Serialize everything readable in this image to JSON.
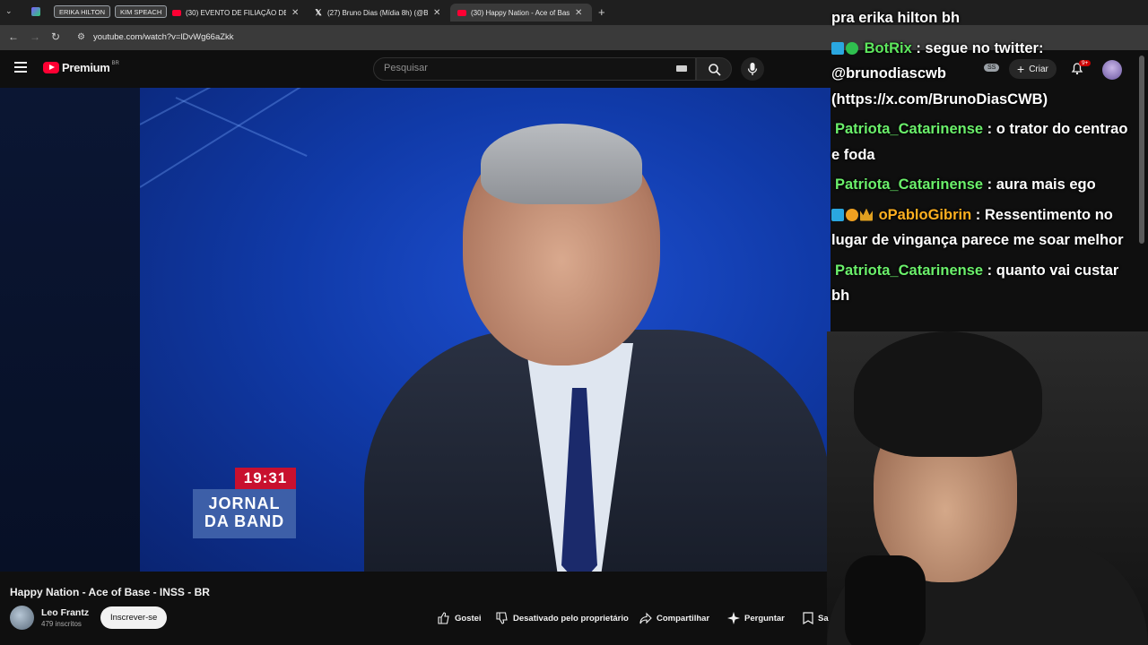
{
  "browser": {
    "pills": [
      "ERIKA HILTON",
      "KIM SPEACH"
    ],
    "tabs": [
      {
        "title": "(30) EVENTO DE FILIAÇÃO DE K",
        "icon": "youtube-icon"
      },
      {
        "title": "(27) Bruno Dias (Mídia 8h) (@B",
        "icon": "x-icon"
      },
      {
        "title": "(30) Happy Nation - Ace of Bas",
        "icon": "youtube-icon",
        "active": true
      }
    ],
    "url": "youtube.com/watch?v=lDvWg66aZkk"
  },
  "youtube": {
    "logo_text": "Premium",
    "region": "BR",
    "search_placeholder": "Pesquisar",
    "account_initials": "SS",
    "create_label": "Criar",
    "notifications": "9+"
  },
  "video": {
    "clock": "19:31",
    "show_line1": "JORNAL",
    "show_line2": "DA BAND",
    "title": "Happy Nation - Ace of Base - INSS - BR",
    "channel": "Leo Frantz",
    "subscribers": "479 inscritos",
    "subscribe_label": "Inscrever-se",
    "actions": {
      "like": "Gostei",
      "dislike": "Desativado pelo proprietário",
      "share": "Compartilhar",
      "ask": "Perguntar",
      "save": "Sa"
    }
  },
  "chat": {
    "lines": [
      {
        "user": "",
        "text": "pra erika hilton bh"
      },
      {
        "user": "BotRix",
        "text": " : segue no twitter: @brunodiascwb (https://x.com/BrunoDiasCWB)"
      },
      {
        "user": "Patriota_Catarinense",
        "text": " : o trator do centrao e foda"
      },
      {
        "user": "Patriota_Catarinense",
        "text": " : aura mais ego"
      },
      {
        "user": "oPabloGibrin",
        "text": " : Ressentimento no lugar de vingança parece me soar melhor"
      },
      {
        "user": "Patriota_Catarinense",
        "text": " : quanto vai custar bh"
      }
    ]
  }
}
